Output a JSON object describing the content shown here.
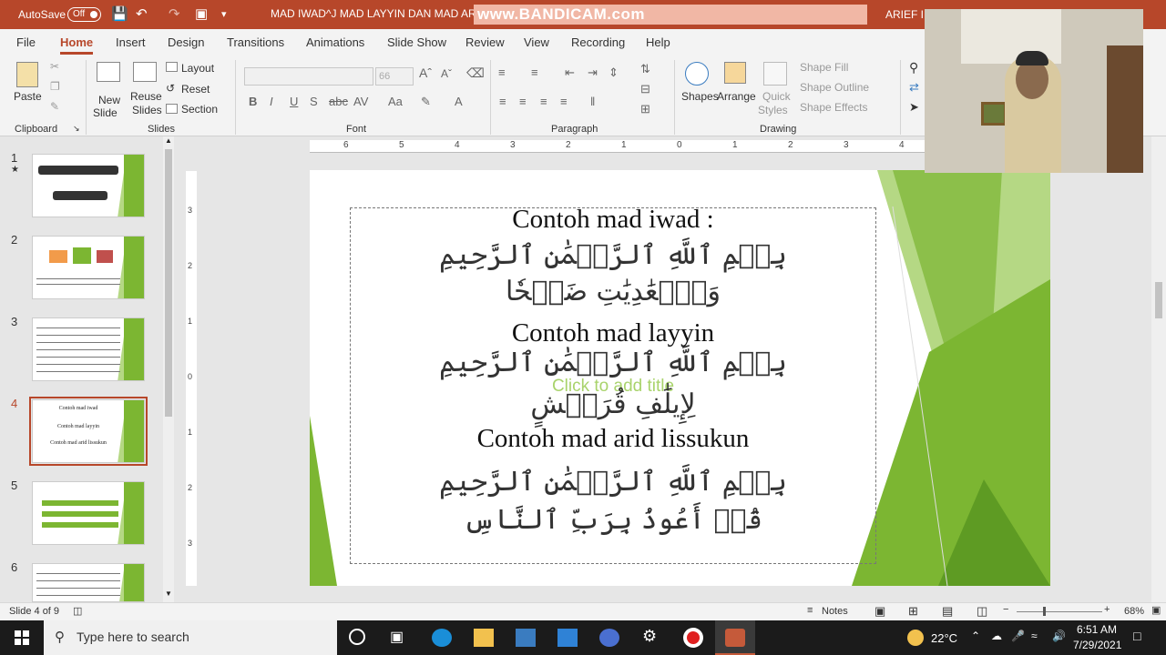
{
  "titlebar": {
    "autosave": "AutoSave",
    "toggle": "Off",
    "doc_title": "MAD IWAD^J MAD LAYYIN DAN MAD ARID L",
    "recorder": "www.BANDICAM.com",
    "user": "ARIEF IM"
  },
  "tabs": [
    "File",
    "Home",
    "Insert",
    "Design",
    "Transitions",
    "Animations",
    "Slide Show",
    "Review",
    "View",
    "Recording",
    "Help"
  ],
  "ribbon": {
    "paste": "Paste",
    "new_slide": "New",
    "new_slide2": "Slide",
    "reuse": "Reuse",
    "reuse2": "Slides",
    "layout": "Layout",
    "reset": "Reset",
    "section": "Section",
    "font_size": "66",
    "shapes": "Shapes",
    "arrange": "Arrange",
    "quick": "Quick",
    "quick2": "Styles",
    "shape_fill": "Shape Fill",
    "shape_outline": "Shape Outline",
    "shape_effects": "Shape Effects",
    "groups": {
      "clipboard": "Clipboard",
      "slides": "Slides",
      "font": "Font",
      "paragraph": "Paragraph",
      "drawing": "Drawing"
    }
  },
  "slides": [
    {
      "num": "1",
      "star": "★"
    },
    {
      "num": "2"
    },
    {
      "num": "3"
    },
    {
      "num": "4"
    },
    {
      "num": "5"
    },
    {
      "num": "6"
    }
  ],
  "thumb4": {
    "t1": "Contoh mad iwad",
    "t2": "Contoh mad layyin",
    "t3": "Contoh mad arid lissukun"
  },
  "slide": {
    "title1": "Contoh mad iwad :",
    "arab1": "بِسۡمِ ٱللَّهِ ٱلرَّحۡمَٰنِ ٱلرَّحِيمِ",
    "arab2": "وَٱلۡعَٰدِيَٰتِ ضَبۡحٗا",
    "title2": "Contoh mad layyin",
    "arab3": "بِسۡمِ ٱللَّهِ ٱلرَّحۡمَٰنِ ٱلرَّحِيمِ",
    "placeholder": "Click to add title",
    "arab4": "لِإِيلَٰفِ قُرَيۡشٍ",
    "title3": "Contoh mad arid lissukun",
    "arab5": "بِسۡمِ ٱللَّهِ ٱلرَّحۡمَٰنِ ٱلرَّحِيمِ",
    "arab6": "قُلۡ أَعُوذُ بِرَبِّ ٱلنَّاسِ"
  },
  "ruler_h": [
    "6",
    "5",
    "4",
    "3",
    "2",
    "1",
    "0",
    "1",
    "2",
    "3",
    "4"
  ],
  "ruler_v": [
    "3",
    "2",
    "1",
    "0",
    "1",
    "2",
    "3"
  ],
  "status": {
    "slide_info": "Slide 4 of 9",
    "notes": "Notes",
    "zoom": "68%"
  },
  "taskbar": {
    "search": "Type here to search",
    "temp": "22°C",
    "time": "6:51 AM",
    "date": "7/29/2021"
  },
  "colors": {
    "accent": "#b7472a",
    "green": "#7cb632",
    "light_green": "#b5d884"
  }
}
